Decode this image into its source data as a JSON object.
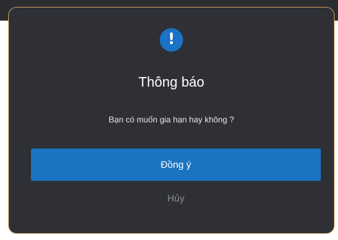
{
  "dialog": {
    "icon": "exclamation-icon",
    "icon_glyph": "!",
    "title": "Thông báo",
    "message": "Bạn có muốn gia hạn hay không ?",
    "confirm_label": "Đồng ý",
    "cancel_label": "Hủy"
  },
  "colors": {
    "dialog_background": "#2e3035",
    "dialog_border": "#c8955a",
    "accent": "#1b73c2",
    "cancel_text": "#8c8e93"
  }
}
